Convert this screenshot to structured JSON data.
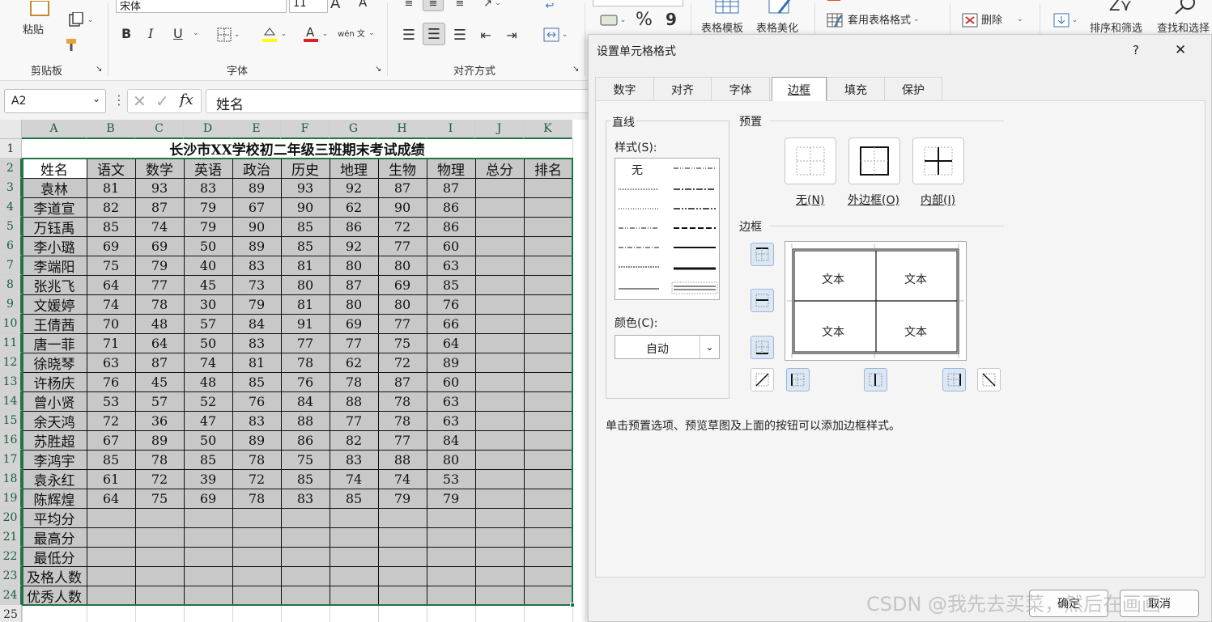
{
  "ribbon": {
    "paste_label": "粘贴",
    "clipboard_group": "剪贴板",
    "font_name": "宋体",
    "font_size": "11",
    "font_group": "字体",
    "bold": "B",
    "italic": "I",
    "underline": "U",
    "phonetic_label": "wén 文",
    "align_group": "对齐方式",
    "percent": "%",
    "comma": "9",
    "table_template": "表格模板",
    "table_beautify": "表格美化",
    "apply_table_format": "套用表格格式",
    "delete": "删除",
    "sort_filter": "排序和筛选",
    "find_select": "查找和选择"
  },
  "formula_bar": {
    "name_box": "A2",
    "fx": "fx",
    "value": "姓名"
  },
  "sheet": {
    "columns": [
      "A",
      "B",
      "C",
      "D",
      "E",
      "F",
      "G",
      "H",
      "I",
      "J",
      "K"
    ],
    "rows": [
      "1",
      "2",
      "3",
      "4",
      "5",
      "6",
      "7",
      "8",
      "9",
      "10",
      "11",
      "12",
      "13",
      "14",
      "15",
      "16",
      "17",
      "18",
      "19",
      "20",
      "21",
      "22",
      "23",
      "24",
      "25"
    ],
    "title": "长沙市XX学校初二年级三班期末考试成绩",
    "headers": [
      "姓名",
      "语文",
      "数学",
      "英语",
      "政治",
      "历史",
      "地理",
      "生物",
      "物理",
      "总分",
      "排名"
    ],
    "students": [
      [
        "袁林",
        "81",
        "93",
        "83",
        "89",
        "93",
        "92",
        "87",
        "87"
      ],
      [
        "李道宣",
        "82",
        "87",
        "79",
        "67",
        "90",
        "62",
        "90",
        "86"
      ],
      [
        "万钰禹",
        "85",
        "74",
        "79",
        "90",
        "85",
        "86",
        "72",
        "86"
      ],
      [
        "李小璐",
        "69",
        "69",
        "50",
        "89",
        "85",
        "92",
        "77",
        "60"
      ],
      [
        "李端阳",
        "75",
        "79",
        "40",
        "83",
        "81",
        "80",
        "80",
        "63"
      ],
      [
        "张兆飞",
        "64",
        "77",
        "45",
        "73",
        "80",
        "87",
        "69",
        "85"
      ],
      [
        "文媛婷",
        "74",
        "78",
        "30",
        "79",
        "81",
        "80",
        "80",
        "76"
      ],
      [
        "王倩茜",
        "70",
        "48",
        "57",
        "84",
        "91",
        "69",
        "77",
        "66"
      ],
      [
        "唐一菲",
        "71",
        "64",
        "50",
        "83",
        "77",
        "77",
        "75",
        "64"
      ],
      [
        "徐晓琴",
        "63",
        "87",
        "74",
        "81",
        "78",
        "62",
        "72",
        "89"
      ],
      [
        "许杨庆",
        "76",
        "45",
        "48",
        "85",
        "76",
        "78",
        "87",
        "60"
      ],
      [
        "曾小贤",
        "53",
        "57",
        "52",
        "76",
        "84",
        "88",
        "78",
        "63"
      ],
      [
        "余天鸿",
        "72",
        "36",
        "47",
        "83",
        "88",
        "77",
        "78",
        "63"
      ],
      [
        "苏胜超",
        "67",
        "89",
        "50",
        "89",
        "86",
        "82",
        "77",
        "84"
      ],
      [
        "李鸿宇",
        "85",
        "78",
        "85",
        "78",
        "75",
        "83",
        "88",
        "80"
      ],
      [
        "袁永红",
        "61",
        "72",
        "39",
        "72",
        "85",
        "74",
        "74",
        "53"
      ],
      [
        "陈辉煌",
        "64",
        "75",
        "69",
        "78",
        "83",
        "85",
        "79",
        "79"
      ]
    ],
    "summary_rows": [
      "平均分",
      "最高分",
      "最低分",
      "及格人数",
      "优秀人数"
    ]
  },
  "dialog": {
    "title": "设置单元格格式",
    "help": "?",
    "close": "✕",
    "tabs": [
      "数字",
      "对齐",
      "字体",
      "边框",
      "填充",
      "保护"
    ],
    "active_tab": "边框",
    "line_section": "直线",
    "style_label": "样式(S):",
    "style_none": "无",
    "color_label": "颜色(C):",
    "color_value": "自动",
    "preset_section": "预置",
    "presets": [
      "无(N)",
      "外边框(O)",
      "内部(I)"
    ],
    "border_section": "边框",
    "preview_text": [
      "文本",
      "文本",
      "文本",
      "文本"
    ],
    "hint": "单击预置选项、预览草图及上面的按钮可以添加边框样式。",
    "ok": "确定",
    "cancel": "取消"
  },
  "watermark": "CSDN @我先去买菜，然后在画画",
  "colors": {
    "selection_fill": "#c8c8c8",
    "accent": "#217346",
    "active_border": "#0f6b3d"
  }
}
